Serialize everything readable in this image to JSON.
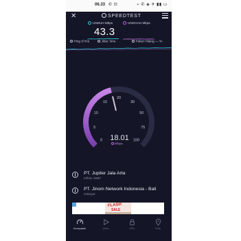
{
  "status_bar": {
    "time": "06.33",
    "left_icons": "✆ ⊡",
    "right_icons": "⌁ ✆ ◈ ✈ ▮▮ ▭"
  },
  "header": {
    "title": "SPEEDTEST"
  },
  "results": {
    "download_label": "UNDUH Mbps",
    "download_value": "43.3",
    "upload_label": "UNGGAH Mbps",
    "ping_label": "Ping",
    "ping_value": "67ms",
    "jitter_label": "Jitter",
    "jitter_value": "3ms",
    "packet_loss_label": "Paket Hilang",
    "packet_loss_value": "— %"
  },
  "gauge": {
    "current_value": "18.01",
    "unit": "Mbps",
    "tick_labels": [
      "0",
      "5",
      "10",
      "15",
      "20",
      "30",
      "50",
      "75",
      "100"
    ],
    "current_reading": 18.01,
    "accent_color": "#b56bd6"
  },
  "servers": [
    {
      "title": "PT. Jupiter Jala Arta",
      "subtitle": "Infinix X687"
    },
    {
      "title": "PT. Jinom Network Indonesia - Bali",
      "subtitle": "Gianyar"
    }
  ],
  "ad": {
    "banner_text_1": "FLASH",
    "banner_text_2": "SALE"
  },
  "bottom_nav": [
    {
      "label": "Kecepatan",
      "icon": "speedometer-icon",
      "active": true
    },
    {
      "label": "Video",
      "icon": "play-icon",
      "active": false
    },
    {
      "label": "VPN",
      "icon": "lock-icon",
      "active": false
    },
    {
      "label": "Peta",
      "icon": "location-pin-icon",
      "active": false
    }
  ],
  "colors": {
    "background": "#141526",
    "download": "#36d3e8",
    "upload": "#b56bd6"
  }
}
